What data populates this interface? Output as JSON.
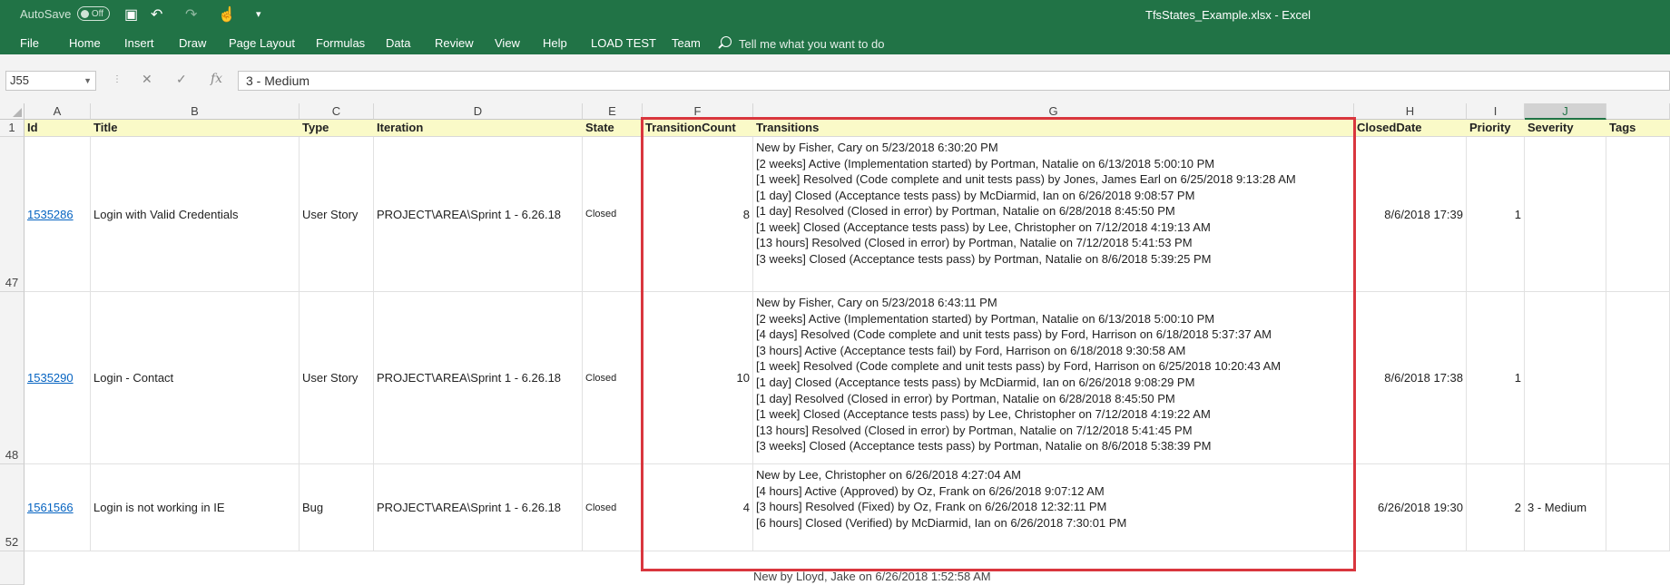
{
  "window": {
    "autosave_label": "AutoSave",
    "autosave_state": "Off",
    "title": "TfsStates_Example.xlsx  -  Excel"
  },
  "ribbon": {
    "tabs": [
      "File",
      "Home",
      "Insert",
      "Draw",
      "Page Layout",
      "Formulas",
      "Data",
      "Review",
      "View",
      "Help",
      "LOAD TEST",
      "Team"
    ],
    "tell_me": "Tell me what you want to do"
  },
  "formula_bar": {
    "name_box": "J55",
    "formula": "3 - Medium"
  },
  "grid": {
    "columns": [
      "A",
      "B",
      "C",
      "D",
      "E",
      "F",
      "G",
      "H",
      "I",
      "J"
    ],
    "header_row_number": "1",
    "headers": [
      "Id",
      "Title",
      "Type",
      "Iteration",
      "State",
      "TransitionCount",
      "Transitions",
      "ClosedDate",
      "Priority",
      "Severity",
      "Tags"
    ],
    "rows": [
      {
        "row_number": "47",
        "id": "1535286",
        "title": "Login with Valid Credentials",
        "type": "User Story",
        "iteration": "PROJECT\\AREA\\Sprint 1 - 6.26.18",
        "state": "Closed",
        "transition_count": "8",
        "transitions": [
          "New by Fisher, Cary on 5/23/2018 6:30:20 PM",
          "[2 weeks] Active (Implementation started) by Portman, Natalie on 6/13/2018 5:00:10 PM",
          "[1 week] Resolved (Code complete and unit tests pass) by Jones, James Earl on 6/25/2018 9:13:28 AM",
          "[1 day] Closed (Acceptance tests pass) by McDiarmid, Ian on 6/26/2018 9:08:57 PM",
          "[1 day] Resolved (Closed in error) by Portman, Natalie on 6/28/2018 8:45:50 PM",
          "[1 week] Closed (Acceptance tests pass) by Lee, Christopher on 7/12/2018 4:19:13 AM",
          "[13 hours] Resolved (Closed in error) by Portman, Natalie on 7/12/2018 5:41:53 PM",
          "[3 weeks] Closed (Acceptance tests pass) by Portman, Natalie on 8/6/2018 5:39:25 PM"
        ],
        "closed_date": "8/6/2018 17:39",
        "priority": "1",
        "severity": ""
      },
      {
        "row_number": "48",
        "id": "1535290",
        "title": "Login - Contact",
        "type": "User Story",
        "iteration": "PROJECT\\AREA\\Sprint 1 - 6.26.18",
        "state": "Closed",
        "transition_count": "10",
        "transitions": [
          "New by Fisher, Cary on 5/23/2018 6:43:11 PM",
          "[2 weeks] Active (Implementation started) by Portman, Natalie on 6/13/2018 5:00:10 PM",
          "[4 days] Resolved (Code complete and unit tests pass) by Ford, Harrison on 6/18/2018 5:37:37 AM",
          "[3 hours] Active (Acceptance tests fail) by Ford, Harrison on 6/18/2018 9:30:58 AM",
          "[1 week] Resolved (Code complete and unit tests pass) by Ford, Harrison on 6/25/2018 10:20:43 AM",
          "[1 day] Closed (Acceptance tests pass) by McDiarmid, Ian on 6/26/2018 9:08:29 PM",
          "[1 day] Resolved (Closed in error) by Portman, Natalie on 6/28/2018 8:45:50 PM",
          "[1 week] Closed (Acceptance tests pass) by Lee, Christopher on 7/12/2018 4:19:22 AM",
          "[13 hours] Resolved (Closed in error) by Portman, Natalie on 7/12/2018 5:41:45 PM",
          "[3 weeks] Closed (Acceptance tests pass) by Portman, Natalie on 8/6/2018 5:38:39 PM"
        ],
        "closed_date": "8/6/2018 17:38",
        "priority": "1",
        "severity": ""
      },
      {
        "row_number": "52",
        "id": "1561566",
        "title": "Login is not working in IE",
        "type": "Bug",
        "iteration": "PROJECT\\AREA\\Sprint 1 - 6.26.18",
        "state": "Closed",
        "transition_count": "4",
        "transitions": [
          "New by Lee, Christopher on 6/26/2018 4:27:04 AM",
          "[4 hours] Active (Approved) by Oz, Frank on 6/26/2018 9:07:12 AM",
          "[3 hours] Resolved (Fixed) by Oz, Frank on 6/26/2018 12:32:11 PM",
          "[6 hours] Closed (Verified) by McDiarmid, Ian on 6/26/2018 7:30:01 PM"
        ],
        "closed_date": "6/26/2018 19:30",
        "priority": "2",
        "severity": "3 - Medium"
      }
    ],
    "partial_row_text": "New by Lloyd, Jake on 6/26/2018 1:52:58 AM"
  },
  "colors": {
    "brand": "#217346",
    "highlight": "#d9363e",
    "link": "#0563c1",
    "header_fill": "#fafac8"
  }
}
